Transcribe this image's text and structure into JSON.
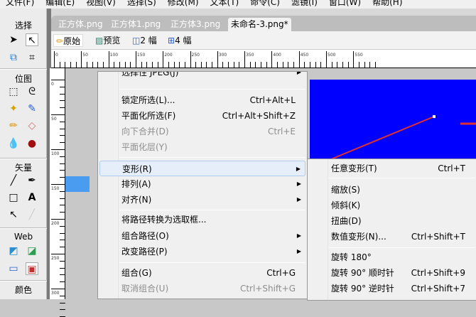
{
  "menubar": [
    "文件(F)",
    "编辑(E)",
    "视图(V)",
    "选择(S)",
    "修改(M)",
    "文本(T)",
    "命令(C)",
    "滤镜(I)",
    "窗口(W)",
    "帮助(H)"
  ],
  "toolbox": {
    "sections": [
      "选择",
      "位图",
      "矢量",
      "Web",
      "颜色"
    ]
  },
  "tabs": [
    "正方体.png",
    "正方体1.png",
    "正方体3.png",
    "未命名-3.png*"
  ],
  "doc_toolbar": {
    "original": "原始",
    "preview": "预览",
    "two_up": "2 幅",
    "four_up": "4 幅"
  },
  "rulers": {
    "h": [
      "0",
      "50",
      "100",
      "150",
      "200",
      "250",
      "300",
      "350",
      "400",
      "450",
      "500",
      "550"
    ],
    "v": [
      "0",
      "50",
      "100",
      "150",
      "200",
      "250",
      "300"
    ]
  },
  "context_menu": [
    {
      "label": "选择性 JPEG(J)",
      "submenu": true,
      "partial": true
    },
    {
      "label": "锁定所选(L)...",
      "shortcut": "Ctrl+Alt+L"
    },
    {
      "label": "平面化所选(F)",
      "shortcut": "Ctrl+Alt+Shift+Z"
    },
    {
      "label": "向下合并(D)",
      "shortcut": "Ctrl+E",
      "disabled": true
    },
    {
      "label": "平面化层(Y)",
      "disabled": true
    },
    {
      "label": "变形(R)",
      "submenu": true,
      "highlighted": true
    },
    {
      "label": "排列(A)",
      "submenu": true
    },
    {
      "label": "对齐(N)",
      "submenu": true
    },
    {
      "label": "将路径转换为选取框..."
    },
    {
      "label": "组合路径(O)",
      "submenu": true
    },
    {
      "label": "改变路径(P)",
      "submenu": true
    },
    {
      "label": "组合(G)",
      "shortcut": "Ctrl+G"
    },
    {
      "label": "取消组合(U)",
      "shortcut": "Ctrl+Shift+G",
      "disabled": true
    }
  ],
  "transform_submenu": [
    {
      "label": "任意变形(T)",
      "shortcut": "Ctrl+T"
    },
    {
      "label": "缩放(S)"
    },
    {
      "label": "倾斜(K)"
    },
    {
      "label": "扭曲(D)"
    },
    {
      "label": "数值变形(N)...",
      "shortcut": "Ctrl+Shift+T"
    },
    {
      "label": "旋转 180°"
    },
    {
      "label": "旋转 90° 顺时针",
      "shortcut": "Ctrl+Shift+9"
    },
    {
      "label": "旋转 90° 逆时针",
      "shortcut": "Ctrl+Shift+7"
    }
  ],
  "colors": {
    "canvas": "#0000ff",
    "line": "#e03030",
    "selection": "#4a9cf0"
  }
}
